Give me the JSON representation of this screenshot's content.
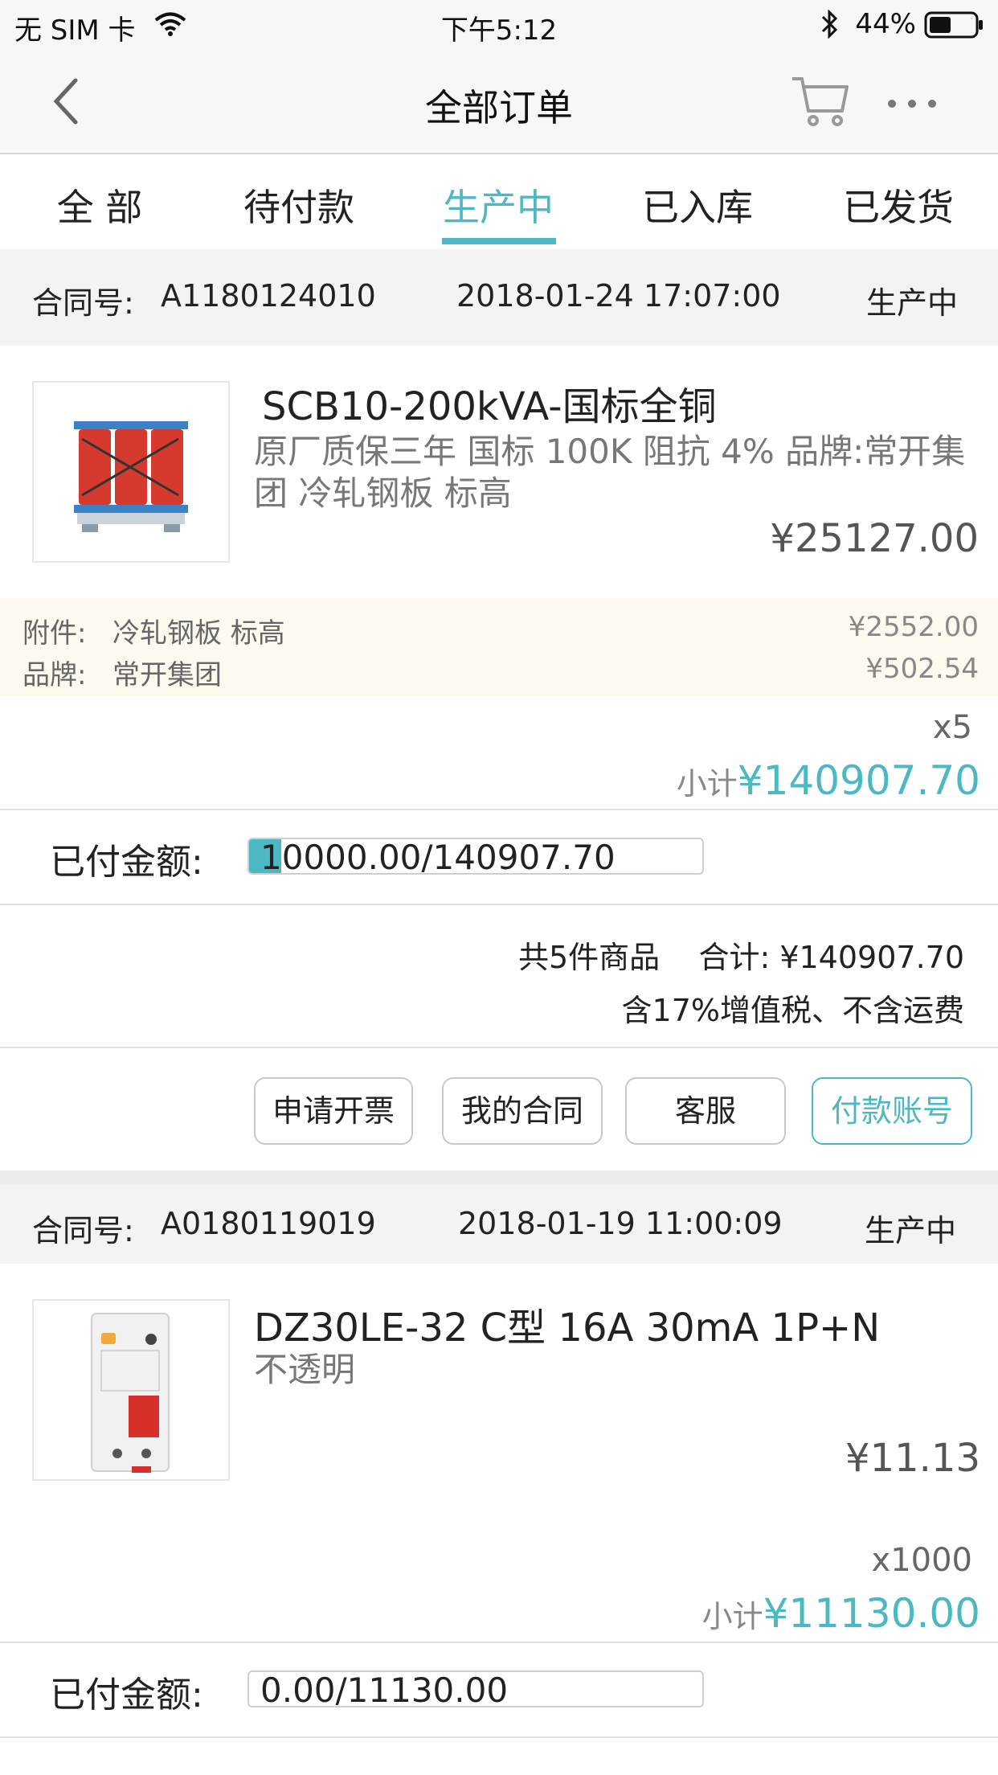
{
  "status_bar": {
    "carrier": "无 SIM 卡",
    "time": "下午5:12",
    "battery": "44%"
  },
  "nav": {
    "title": "全部订单"
  },
  "tabs": [
    {
      "label": "全  部",
      "active": false
    },
    {
      "label": "待付款",
      "active": false
    },
    {
      "label": "生产中",
      "active": true
    },
    {
      "label": "已入库",
      "active": false
    },
    {
      "label": "已发货",
      "active": false
    }
  ],
  "orders": [
    {
      "contract_label": "合同号:",
      "contract_no": "A1180124010",
      "datetime": "2018-01-24 17:07:00",
      "status": "生产中",
      "product_name": "SCB10-200kVA-国标全铜",
      "product_desc": "原厂质保三年 国标 100K 阻抗 4% 品牌:常开集团 冷轧钢板 标高",
      "price": "¥25127.00",
      "attrs": [
        {
          "label": "附件:",
          "value": "冷轧钢板 标高",
          "price": "¥2552.00"
        },
        {
          "label": "品牌:",
          "value": "常开集团",
          "price": "¥502.54"
        }
      ],
      "quantity": "x5",
      "subtotal_label": "小计",
      "subtotal": "¥140907.70",
      "paid_label": "已付金额:",
      "paid_text": "10000.00/140907.70",
      "paid_fraction": 0.071,
      "summary_line1": "共5件商品    合计: ¥140907.70",
      "summary_line2": "含17%增值税、不含运费",
      "buttons": [
        "申请开票",
        "我的合同",
        "客服",
        "付款账号"
      ]
    },
    {
      "contract_label": "合同号:",
      "contract_no": "A0180119019",
      "datetime": "2018-01-19 11:00:09",
      "status": "生产中",
      "product_name": "DZ30LE-32 C型 16A 30mA 1P+N",
      "product_desc": "不透明",
      "price": "¥11.13",
      "quantity": "x1000",
      "subtotal_label": "小计",
      "subtotal": "¥11130.00",
      "paid_label": "已付金额:",
      "paid_text": "0.00/11130.00",
      "paid_fraction": 0.0
    }
  ],
  "colors": {
    "accent": "#4cb8c4",
    "header_bg": "#f7f7f7",
    "attr_bg": "#fdf9ef"
  },
  "icons": [
    "back-chevron-icon",
    "cart-icon",
    "more-dots-icon",
    "wifi-icon",
    "bluetooth-icon",
    "battery-icon"
  ]
}
